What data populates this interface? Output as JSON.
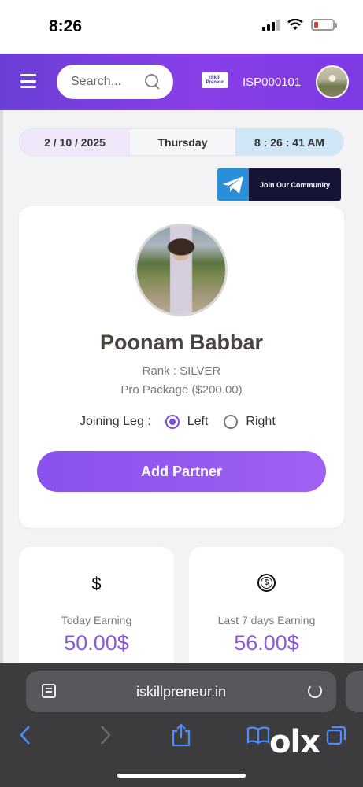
{
  "status_bar": {
    "time": "8:26"
  },
  "header": {
    "search_placeholder": "Search...",
    "logo_text": "iSkill Preneur",
    "user_id": "ISP000101"
  },
  "date_bar": {
    "date": "2 / 10 / 2025",
    "day": "Thursday",
    "time": "8 : 26 : 41 AM"
  },
  "community_button": {
    "label": "Join Our Community"
  },
  "profile": {
    "name": "Poonam Babbar",
    "rank": "Rank : SILVER",
    "package": "Pro Package ($200.00)",
    "joining_leg_label": "Joining Leg :",
    "leg_options": [
      "Left",
      "Right"
    ],
    "selected_leg": "Left",
    "add_partner_label": "Add Partner"
  },
  "earnings": [
    {
      "icon": "dollar-icon",
      "symbol": "$",
      "label": "Today Earning",
      "value": "50.00$"
    },
    {
      "icon": "coin-icon",
      "symbol": "$",
      "label": "Last 7 days Earning",
      "value": "56.00$"
    }
  ],
  "browser": {
    "url": "iskillpreneur.in"
  },
  "watermark": "olx",
  "colors": {
    "header_gradient_start": "#6a3fd6",
    "header_gradient_end": "#8a3ee8",
    "accent": "#8952ee",
    "value_purple": "#8a5ae0",
    "telegram_blue": "#2a8fd8"
  }
}
